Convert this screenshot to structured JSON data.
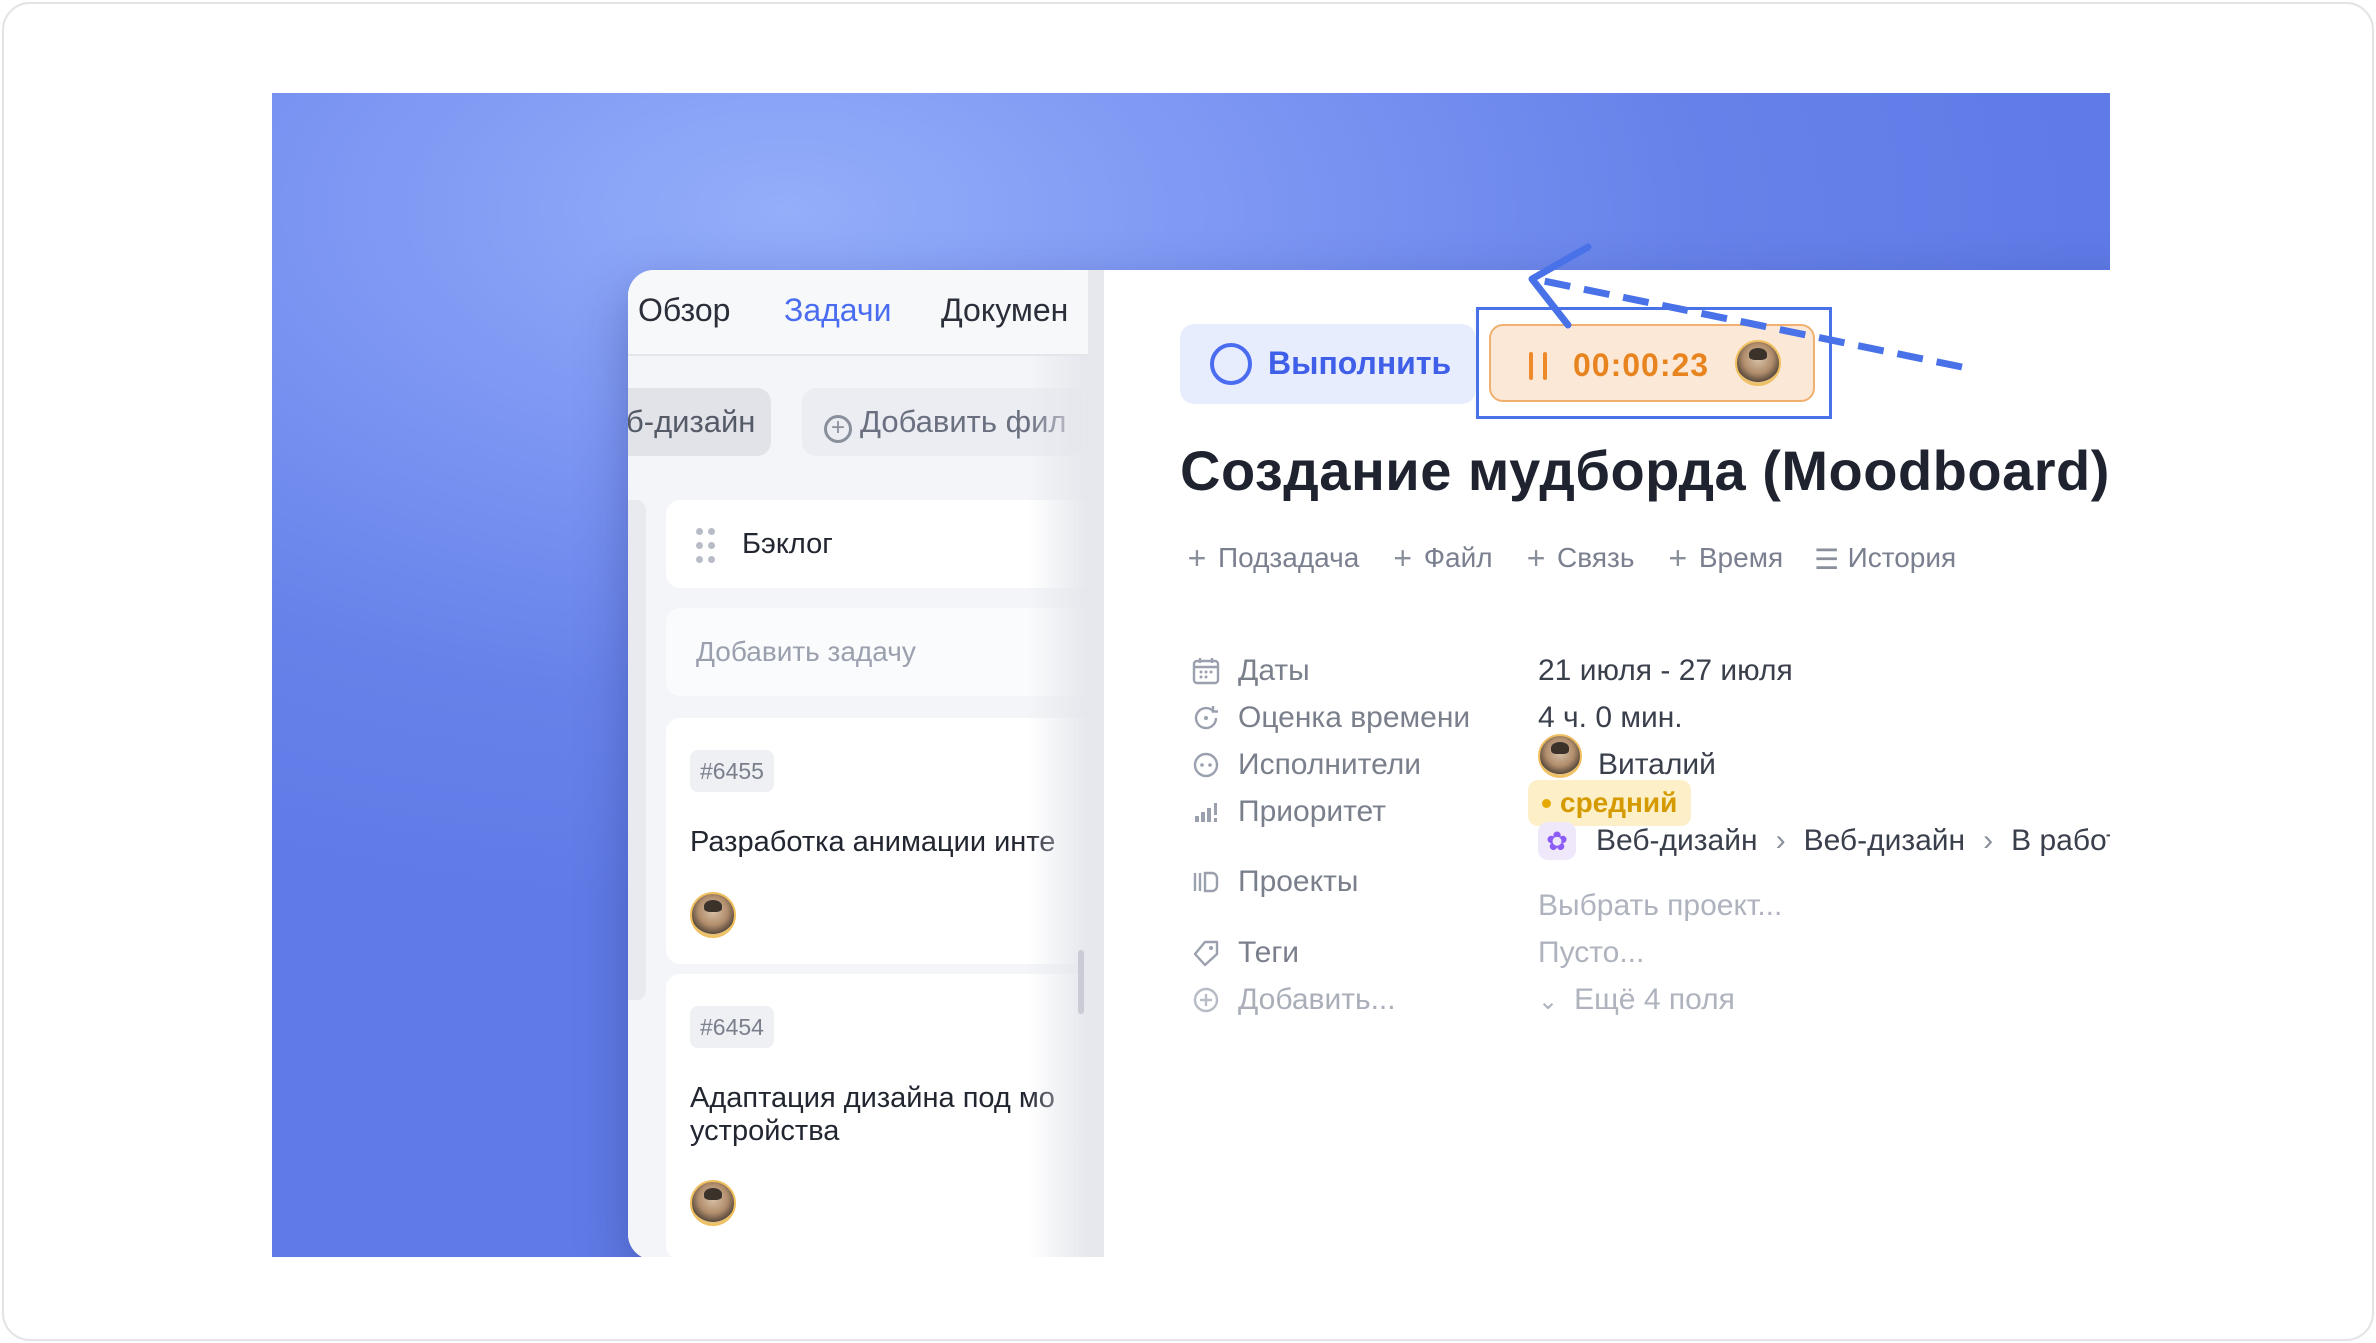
{
  "nav": {
    "tabs": [
      {
        "label": "Обзор",
        "active": false
      },
      {
        "label": "Задачи",
        "active": true
      },
      {
        "label": "Докумен",
        "active": false
      }
    ]
  },
  "filters": {
    "project_chip": "б-дизайн",
    "add_filter": "Добавить фил"
  },
  "board": {
    "column_title": "Бэклог",
    "add_task_placeholder": "Добавить задачу",
    "tasks": [
      {
        "id": "#6455",
        "title_line1": "Разработка анимации инте",
        "title_line2": ""
      },
      {
        "id": "#6454",
        "title_line1": "Адаптация дизайна под мо",
        "title_line2": "устройства"
      }
    ]
  },
  "task": {
    "complete_label": "Выполнить",
    "timer": "00:00:23",
    "title": "Создание мудборда (Moodboard)",
    "actions": [
      {
        "icon": "plus-icon",
        "label": "Подзадача"
      },
      {
        "icon": "plus-icon",
        "label": "Файл"
      },
      {
        "icon": "plus-icon",
        "label": "Связь"
      },
      {
        "icon": "plus-icon",
        "label": "Время"
      },
      {
        "icon": "list-icon",
        "label": "История"
      }
    ],
    "fields": {
      "dates": {
        "label": "Даты",
        "value": "21 июля - 27 июля"
      },
      "estimate": {
        "label": "Оценка времени",
        "value": "4 ч. 0 мин."
      },
      "assignees": {
        "label": "Исполнители",
        "value": "Виталий"
      },
      "priority": {
        "label": "Приоритет",
        "value": "средний"
      },
      "projects": {
        "label": "Проекты",
        "path": [
          "Веб-дизайн",
          "Веб-дизайн",
          "В работе"
        ],
        "choose_placeholder": "Выбрать проект..."
      },
      "tags": {
        "label": "Теги",
        "value": "Пусто..."
      },
      "add": {
        "label": "Добавить...",
        "more": "Ещё 4 поля"
      }
    }
  },
  "colors": {
    "accent": "#4a6cf0",
    "timer_text": "#e8841f",
    "timer_bg": "#fbe8d6",
    "priority_text": "#d49a00",
    "priority_bg": "#fdf0c8",
    "background": "#6f8bee"
  }
}
